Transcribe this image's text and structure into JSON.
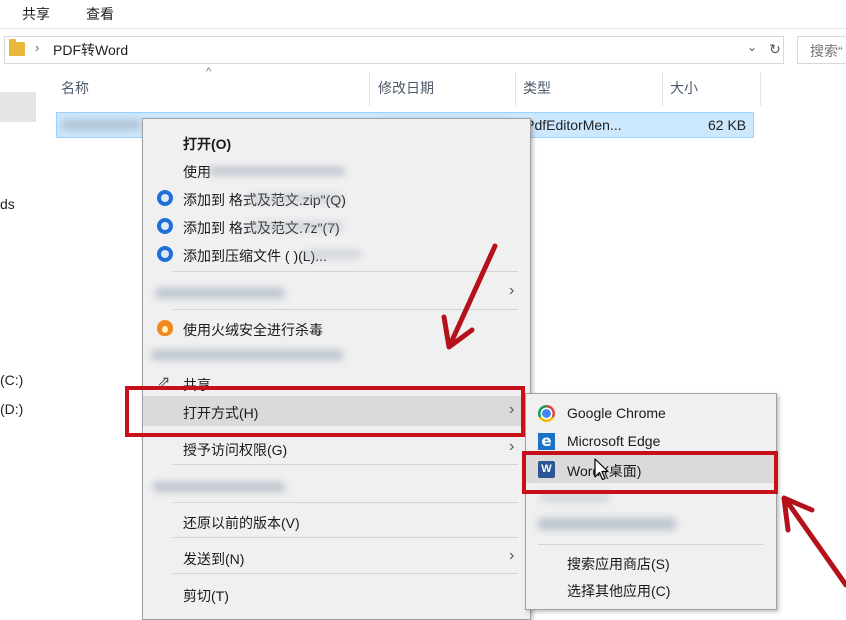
{
  "ribbon": {
    "tabs": [
      "共享",
      "查看"
    ]
  },
  "address": {
    "path": "PDF转Word",
    "chevron": "›",
    "dropdown": "⌄",
    "refresh": "↻"
  },
  "search": {
    "placeholder": "搜索“"
  },
  "nav": {
    "items": [
      "ds",
      "(C:)",
      "(D:)"
    ]
  },
  "columns": {
    "name": "名称",
    "modified": "修改日期",
    "type": "类型",
    "size": "大小"
  },
  "file_row": {
    "type": "iPdfEditorMen...",
    "size": "62 KB"
  },
  "context_menu": {
    "open": "打开(O)",
    "use_prefix": "使用",
    "add_zip": "添加到                 格式及范文.zip\"(Q)",
    "add_7z": "添加到                 格式及范文.7z\"(7)",
    "add_archive": "添加到压缩文件 (                )(L)...",
    "scan": "使用火绒安全进行杀毒",
    "share": "共享",
    "open_with": "打开方式(H)",
    "grant_access": "授予访问权限(G)",
    "restore": "还原以前的版本(V)",
    "send_to": "发送到(N)",
    "cut": "剪切(T)",
    "arrow": "›"
  },
  "submenu": {
    "chrome": "Google Chrome",
    "edge": "Microsoft Edge",
    "word": "Word (桌面)",
    "store": "搜索应用商店(S)",
    "other": "选择其他应用(C)"
  },
  "icons": {
    "edge_glyph": "e",
    "word_glyph": "W",
    "share_glyph": "⇗"
  },
  "colors": {
    "highlight_box": "#c8101a",
    "selection": "#cce8ff",
    "annotation_arrow": "#b3121b"
  }
}
